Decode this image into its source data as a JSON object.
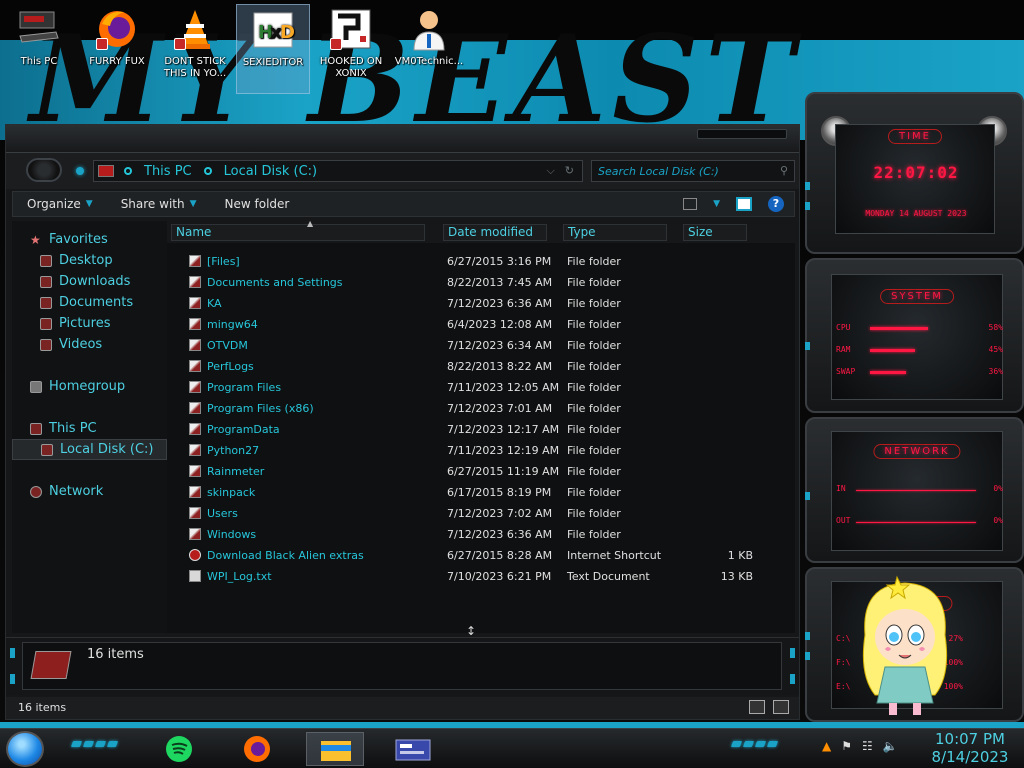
{
  "desktop": {
    "wallpaper_text": "MY BEAST",
    "icons": [
      {
        "label": "This PC",
        "icon": "this-pc-icon"
      },
      {
        "label": "FURRY FUX",
        "icon": "firefox-icon"
      },
      {
        "label": "DONT STICK THIS IN YO...",
        "icon": "vlc-icon"
      },
      {
        "label": "SEXIEDITOR",
        "icon": "hxd-icon",
        "selected": true
      },
      {
        "label": "HOOKED ON XONIX",
        "icon": "xonix-icon"
      },
      {
        "label": "VM0Technic...",
        "icon": "doctor-icon"
      }
    ]
  },
  "explorer": {
    "breadcrumb": [
      "This PC",
      "Local Disk (C:)"
    ],
    "search_placeholder": "Search Local Disk (C:)",
    "toolbar": {
      "organize": "Organize",
      "share_with": "Share with",
      "new_folder": "New folder",
      "help": "?"
    },
    "nav": {
      "favorites": "Favorites",
      "favorites_items": [
        "Desktop",
        "Downloads",
        "Documents",
        "Pictures",
        "Videos"
      ],
      "homegroup": "Homegroup",
      "this_pc": "This PC",
      "local_disk": "Local Disk (C:)",
      "network": "Network"
    },
    "columns": {
      "name": "Name",
      "date": "Date modified",
      "type": "Type",
      "size": "Size"
    },
    "files": [
      {
        "name": "[Files]",
        "date": "6/27/2015 3:16 PM",
        "type": "File folder",
        "size": "",
        "kind": "folder"
      },
      {
        "name": "Documents and Settings",
        "date": "8/22/2013 7:45 AM",
        "type": "File folder",
        "size": "",
        "kind": "folder"
      },
      {
        "name": "KA",
        "date": "7/12/2023 6:36 AM",
        "type": "File folder",
        "size": "",
        "kind": "folder"
      },
      {
        "name": "mingw64",
        "date": "6/4/2023 12:08 AM",
        "type": "File folder",
        "size": "",
        "kind": "folder"
      },
      {
        "name": "OTVDM",
        "date": "7/12/2023 6:34 AM",
        "type": "File folder",
        "size": "",
        "kind": "folder"
      },
      {
        "name": "PerfLogs",
        "date": "8/22/2013 8:22 AM",
        "type": "File folder",
        "size": "",
        "kind": "folder"
      },
      {
        "name": "Program Files",
        "date": "7/11/2023 12:05 AM",
        "type": "File folder",
        "size": "",
        "kind": "folder"
      },
      {
        "name": "Program Files (x86)",
        "date": "7/12/2023 7:01 AM",
        "type": "File folder",
        "size": "",
        "kind": "folder"
      },
      {
        "name": "ProgramData",
        "date": "7/12/2023 12:17 AM",
        "type": "File folder",
        "size": "",
        "kind": "folder"
      },
      {
        "name": "Python27",
        "date": "7/11/2023 12:19 AM",
        "type": "File folder",
        "size": "",
        "kind": "folder"
      },
      {
        "name": "Rainmeter",
        "date": "6/27/2015 11:19 AM",
        "type": "File folder",
        "size": "",
        "kind": "folder"
      },
      {
        "name": "skinpack",
        "date": "6/17/2015 8:19 PM",
        "type": "File folder",
        "size": "",
        "kind": "folder"
      },
      {
        "name": "Users",
        "date": "7/12/2023 7:02 AM",
        "type": "File folder",
        "size": "",
        "kind": "folder"
      },
      {
        "name": "Windows",
        "date": "7/12/2023 6:36 AM",
        "type": "File folder",
        "size": "",
        "kind": "folder"
      },
      {
        "name": "Download Black Alien extras",
        "date": "6/27/2015 8:28 AM",
        "type": "Internet Shortcut",
        "size": "1 KB",
        "kind": "link"
      },
      {
        "name": "WPI_Log.txt",
        "date": "7/10/2023 6:21 PM",
        "type": "Text Document",
        "size": "13 KB",
        "kind": "text"
      }
    ],
    "details_count": "16 items",
    "status_count": "16 items"
  },
  "gadgets": {
    "time_title": "TIME",
    "time_value": "22:07:02",
    "date_value": "MONDAY 14 AUGUST 2023",
    "system_title": "SYSTEM",
    "system_rows": [
      {
        "label": "CPU",
        "value": "58%",
        "level": 0.58
      },
      {
        "label": "RAM",
        "value": "45%",
        "level": 0.45
      },
      {
        "label": "SWAP",
        "value": "36%",
        "level": 0.36
      }
    ],
    "network_title": "NETWORK",
    "network_rows": [
      {
        "label": "IN",
        "value": "0%"
      },
      {
        "label": "OUT",
        "value": "0%"
      }
    ],
    "drives_title": "DRIVES",
    "drive_rows": [
      {
        "label": "C:\\",
        "value": "27%"
      },
      {
        "label": "F:\\",
        "value": "100%"
      },
      {
        "label": "E:\\",
        "value": "100%"
      }
    ]
  },
  "taskbar": {
    "apps": [
      "spotify-icon",
      "firefox-icon",
      "file-explorer-icon",
      "control-panel-icon"
    ],
    "time": "10:07 PM",
    "date": "8/14/2023"
  },
  "colors": {
    "accent": "#1aa3c7",
    "link_text": "#26c6da",
    "gadget_red": "#ff1744"
  }
}
